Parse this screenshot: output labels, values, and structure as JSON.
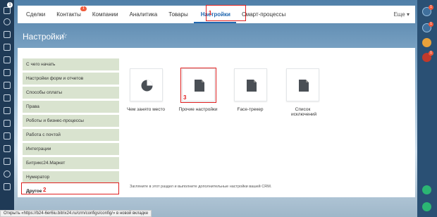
{
  "nav": {
    "items": [
      "Сделки",
      "Контакты",
      "Компании",
      "Аналитика",
      "Товары",
      "Настройки",
      "Смарт-процессы"
    ],
    "contacts_counter": "1",
    "more": "Еще"
  },
  "page": {
    "title": "Настройки"
  },
  "sidebar": {
    "items": [
      "С чего начать",
      "Настройки форм и отчетов",
      "Способы оплаты",
      "Права",
      "Роботы и бизнес-процессы",
      "Работа с почтой",
      "Интеграции",
      "Битрикс24.Маркет",
      "Нумератор",
      "Другое"
    ]
  },
  "tiles": [
    {
      "label": "Чем занято место",
      "icon": "pie-chart-icon"
    },
    {
      "label": "Прочие настройки",
      "icon": "document-icon"
    },
    {
      "label": "Face-трекер",
      "icon": "document-icon"
    },
    {
      "label": "Список исключений",
      "icon": "document-icon"
    }
  ],
  "footer_text": "Загляните в этот раздел и выполните дополнительные настройки вашей CRM.",
  "annotations": {
    "n1": "1",
    "n2": "2",
    "n3": "3"
  },
  "status_bar": "Открыть «https://b24-6er6iu.bitrix24.ru/crm/configs/config/» в новой вкладке",
  "left_bar": {
    "badge": "1"
  },
  "right_bar": {
    "badge_top": "1",
    "badge_2": "1",
    "badge_3": "1"
  },
  "colors": {
    "accent": "#2067b0",
    "annotation": "#e02020",
    "sidebar_item": "#d9e3cf"
  }
}
